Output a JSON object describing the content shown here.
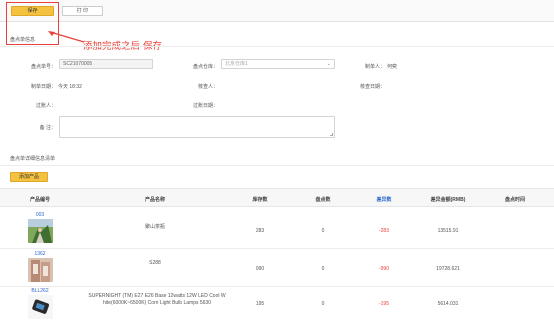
{
  "toolbar": {
    "save_label": "保存",
    "print_label": "打 印"
  },
  "annotation": {
    "text": "添加完成之后 保存"
  },
  "info_section": {
    "title": "盘点单信息"
  },
  "form": {
    "order_no_label": "盘点单号：",
    "order_no_value": "SC21070005",
    "warehouse_label": "盘点仓库：",
    "warehouse_value": "北京仓库1",
    "creator_label": "制单人：",
    "creator_value": "何奕",
    "create_date_label": "制单日期：",
    "create_date_value": "今天 18:32",
    "checker_label": "核查人：",
    "checker_value": "",
    "check_date_label": "核查日期：",
    "check_date_value": "",
    "poster_label": "过账人：",
    "poster_value": "",
    "post_date_label": "过账日期：",
    "post_date_value": "",
    "remark_label": "备 注："
  },
  "detail_section": {
    "title": "盘点单详细信息清单",
    "add_button": "添加产品"
  },
  "table": {
    "headers": [
      "产品编号",
      "产品名称",
      "库存数",
      "盘点数",
      "差异数",
      "差异金额(RMB)",
      "盘点时间"
    ],
    "rows": [
      {
        "code": "003",
        "name": "聚山茶瓶",
        "stock": "283",
        "counted": "0",
        "diff": "-283",
        "amount": "13515.91",
        "time": ""
      },
      {
        "code": "1362",
        "name": "S288",
        "stock": "990",
        "counted": "0",
        "diff": "-990",
        "amount": "19728.621",
        "time": ""
      },
      {
        "code": "BLL262",
        "name": "SUPERNIGHT (TM) E27 E26 Base 12watts 12W LED Cool W hite(6000K~6500K) Corn Light Bulb Lamps 5630",
        "stock": "195",
        "counted": "0",
        "diff": "-195",
        "amount": "5614.031",
        "time": ""
      }
    ]
  },
  "colors": {
    "accent": "#f4c23f",
    "annotation": "#e8403a",
    "link": "#2d67c9"
  }
}
